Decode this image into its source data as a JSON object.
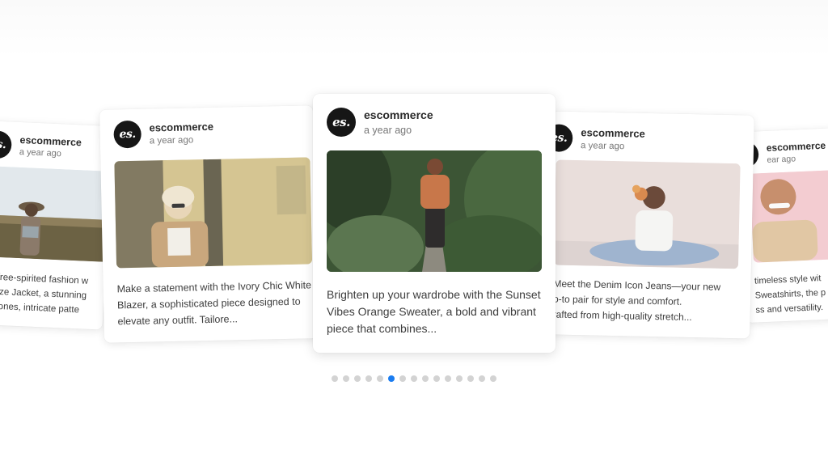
{
  "colors": {
    "avatar_bg": "#161616",
    "active_dot": "#1a7cf0",
    "inactive_dot": "#d3d3d3"
  },
  "cards": [
    {
      "avatar_text": "es.",
      "author": "escommerce",
      "time": "a year ago",
      "image": "woman-with-hat-in-field-photo",
      "caption": "e free-spirited fashion w\neeze Jacket, a stunning\ny tones, intricate patte"
    },
    {
      "avatar_text": "es.",
      "author": "escommerce",
      "time": "a year ago",
      "image": "woman-in-ivory-blazer-photo",
      "caption": "Make a statement with the Ivory Chic White Blazer, a sophisticated piece designed to elevate any outfit. Tailore..."
    },
    {
      "avatar_text": "es.",
      "author": "escommerce",
      "time": "a year ago",
      "image": "woman-in-orange-sweater-photo",
      "caption": "Brighten up your wardrobe with the Sunset Vibes Orange Sweater, a bold and vibrant piece that combines..."
    },
    {
      "avatar_text": "es.",
      "author": "escommerce",
      "time": "a year ago",
      "image": "woman-in-denim-jeans-photo",
      "caption": "Meet the Denim Icon Jeans—your new\no-to pair for style and comfort.\nrafted from high-quality stretch..."
    },
    {
      "avatar_text": "es.",
      "author": "escommerce",
      "time": "ear ago",
      "image": "man-in-beige-sweatshirt-photo",
      "caption": "timeless style wit\nSweatshirts, the p\nss and versatility."
    }
  ],
  "pager": {
    "total": 15,
    "active_index": 5
  }
}
